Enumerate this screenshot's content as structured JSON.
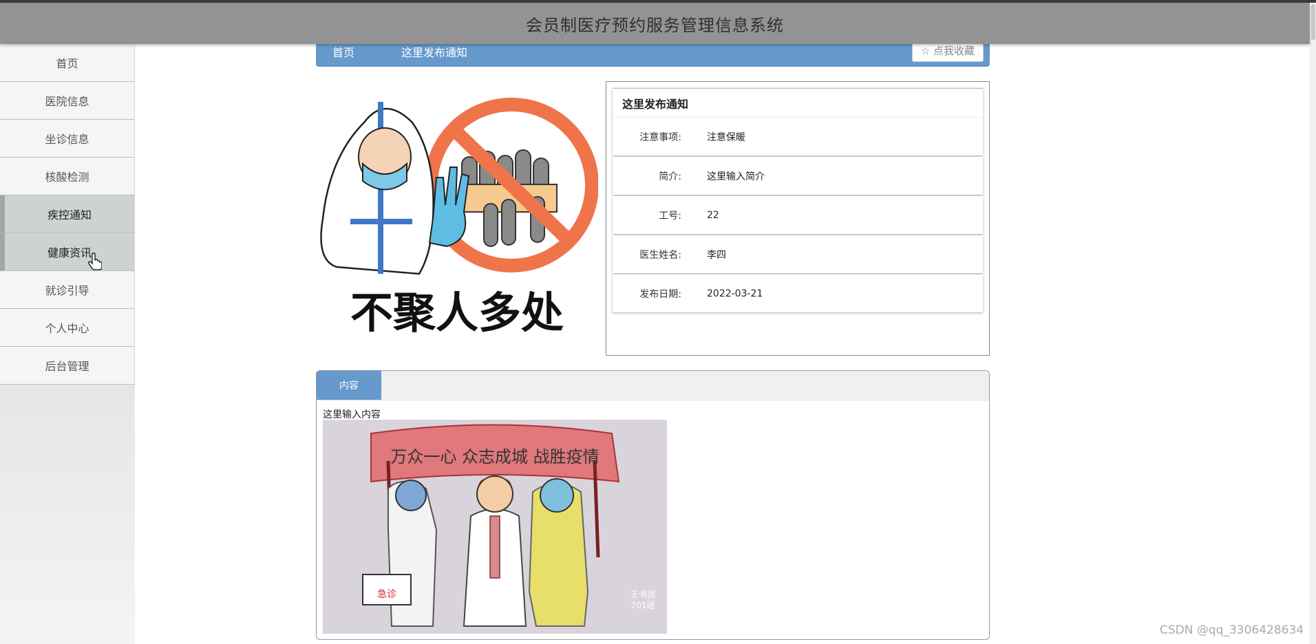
{
  "header": {
    "title": "会员制医疗预约服务管理信息系统"
  },
  "sidebar": {
    "items": [
      {
        "label": "首页"
      },
      {
        "label": "医院信息"
      },
      {
        "label": "坐诊信息"
      },
      {
        "label": "核酸检测"
      },
      {
        "label": "疾控通知"
      },
      {
        "label": "健康资讯"
      },
      {
        "label": "就诊引导"
      },
      {
        "label": "个人中心"
      },
      {
        "label": "后台管理"
      }
    ]
  },
  "breadcrumb": {
    "home": "首页",
    "current": "这里发布通知",
    "favorite": "☆ 点我收藏"
  },
  "poster": {
    "caption": "不聚人多处"
  },
  "detail": {
    "title": "这里发布通知",
    "rows": [
      {
        "label": "注意事项:",
        "value": "注意保暖"
      },
      {
        "label": "简介:",
        "value": "这里输入简介"
      },
      {
        "label": "工号:",
        "value": "22"
      },
      {
        "label": "医生姓名:",
        "value": "李四"
      },
      {
        "label": "发布日期:",
        "value": "2022-03-21"
      }
    ]
  },
  "content": {
    "tab": "内容",
    "text": "这里输入内容",
    "image": {
      "banner": "万众一心 众志成城 战胜疫情",
      "box_label": "急诊",
      "signature": "王书润",
      "class": "701班"
    }
  },
  "watermark": "CSDN @qq_3306428634"
}
